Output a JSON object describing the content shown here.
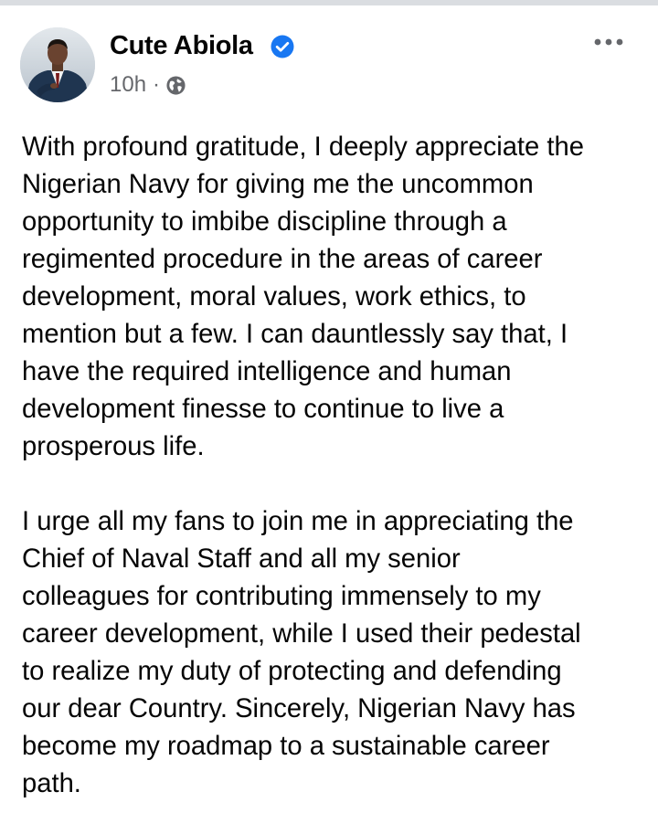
{
  "post": {
    "author": "Cute Abiola",
    "verified_icon": "verified-badge-icon",
    "time": "10h",
    "separator": "·",
    "privacy_icon": "globe-icon",
    "more_icon": "more-options-icon",
    "paragraphs": [
      "With profound gratitude, I deeply appreciate the\nNigerian Navy for giving me the uncommon\nopportunity to imbibe discipline through a\nregimented procedure in the areas of career\ndevelopment, moral values, work ethics, to\nmention but a few. I can dauntlessly say that, I\nhave the required intelligence and human\ndevelopment finesse to continue to live a\nprosperous life.",
      "I urge all my fans to join me in appreciating the\nChief of Naval Staff and all my senior\ncolleagues for contributing immensely to my\ncareer development, while I used their pedestal\nto realize my duty of protecting and defending\nour dear Country. Sincerely, Nigerian Navy has\nbecome my roadmap to a sustainable career\npath."
    ]
  },
  "colors": {
    "verified_blue": "#1877f2",
    "meta_gray": "#65676b",
    "text": "#050505"
  }
}
